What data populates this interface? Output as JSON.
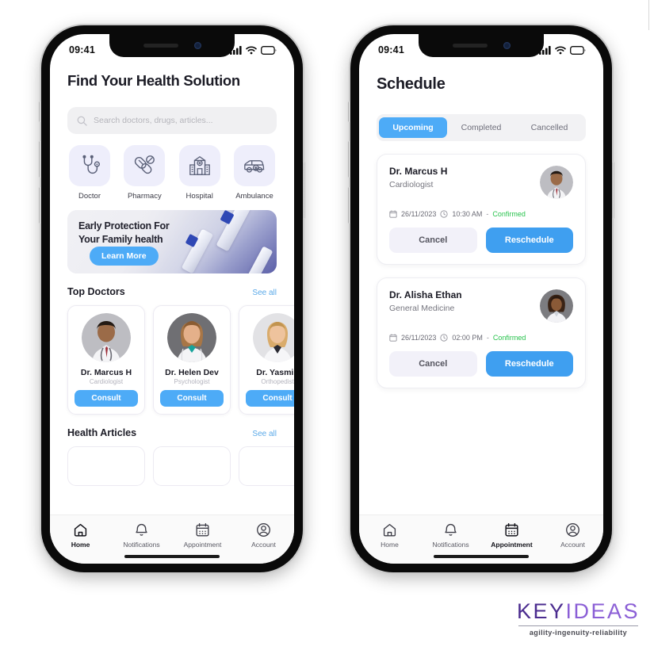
{
  "phones": [
    {
      "status": {
        "time": "09:41",
        "icons": [
          "signal-icon",
          "wifi-icon",
          "battery-icon"
        ]
      },
      "title": "Find Your Health Solution",
      "search": {
        "placeholder": "Search doctors, drugs, articles..."
      },
      "categories": [
        {
          "label": "Doctor",
          "icon": "stethoscope-icon"
        },
        {
          "label": "Pharmacy",
          "icon": "pills-icon"
        },
        {
          "label": "Hospital",
          "icon": "hospital-icon"
        },
        {
          "label": "Ambulance",
          "icon": "ambulance-icon"
        }
      ],
      "banner": {
        "line1": "Early Protection For",
        "line2": "Your Family health",
        "cta": "Learn More"
      },
      "sections": [
        {
          "title": "Top Doctors",
          "link": "See all"
        },
        {
          "title": "Health Articles",
          "link": "See all"
        }
      ],
      "doctors": [
        {
          "name": "Dr. Marcus H",
          "specialty": "Cardiologist",
          "action": "Consult"
        },
        {
          "name": "Dr. Helen Dev",
          "specialty": "Psychologist",
          "action": "Consult"
        },
        {
          "name": "Dr. Yasmin",
          "specialty": "Orthopedist",
          "action": "Consult"
        }
      ],
      "nav": [
        {
          "label": "Home",
          "icon": "home-icon",
          "active": true
        },
        {
          "label": "Notifications",
          "icon": "bell-icon",
          "active": false
        },
        {
          "label": "Appointment",
          "icon": "calendar-icon",
          "active": false
        },
        {
          "label": "Account",
          "icon": "user-icon",
          "active": false
        }
      ]
    },
    {
      "status": {
        "time": "09:41",
        "icons": [
          "signal-icon",
          "wifi-icon",
          "battery-icon"
        ]
      },
      "title": "Schedule",
      "tabs": [
        {
          "label": "Upcoming",
          "active": true
        },
        {
          "label": "Completed",
          "active": false
        },
        {
          "label": "Cancelled",
          "active": false
        }
      ],
      "appointments": [
        {
          "name": "Dr. Marcus H",
          "specialty": "Cardiologist",
          "date": "26/11/2023",
          "time": "10:30 AM",
          "separator": "-",
          "status": "Confirmed",
          "cancel": "Cancel",
          "reschedule": "Reschedule"
        },
        {
          "name": "Dr. Alisha Ethan",
          "specialty": "General Medicine",
          "date": "26/11/2023",
          "time": "02:00 PM",
          "separator": "-",
          "status": "Confirmed",
          "cancel": "Cancel",
          "reschedule": "Reschedule"
        }
      ],
      "nav": [
        {
          "label": "Home",
          "icon": "home-icon",
          "active": false
        },
        {
          "label": "Notifications",
          "icon": "bell-icon",
          "active": false
        },
        {
          "label": "Appointment",
          "icon": "calendar-icon",
          "active": true
        },
        {
          "label": "Account",
          "icon": "user-icon",
          "active": false
        }
      ]
    }
  ],
  "logo": {
    "part1": "KEY",
    "part2": "IDEAS",
    "tagline": "agility-ingenuity-reliability"
  },
  "colors": {
    "accent_blue": "#4dabf7",
    "status_green": "#27c24c",
    "tile_lavender": "#eeeefb",
    "logo_dark": "#4b2c8f",
    "logo_light": "#8b5fd6"
  }
}
